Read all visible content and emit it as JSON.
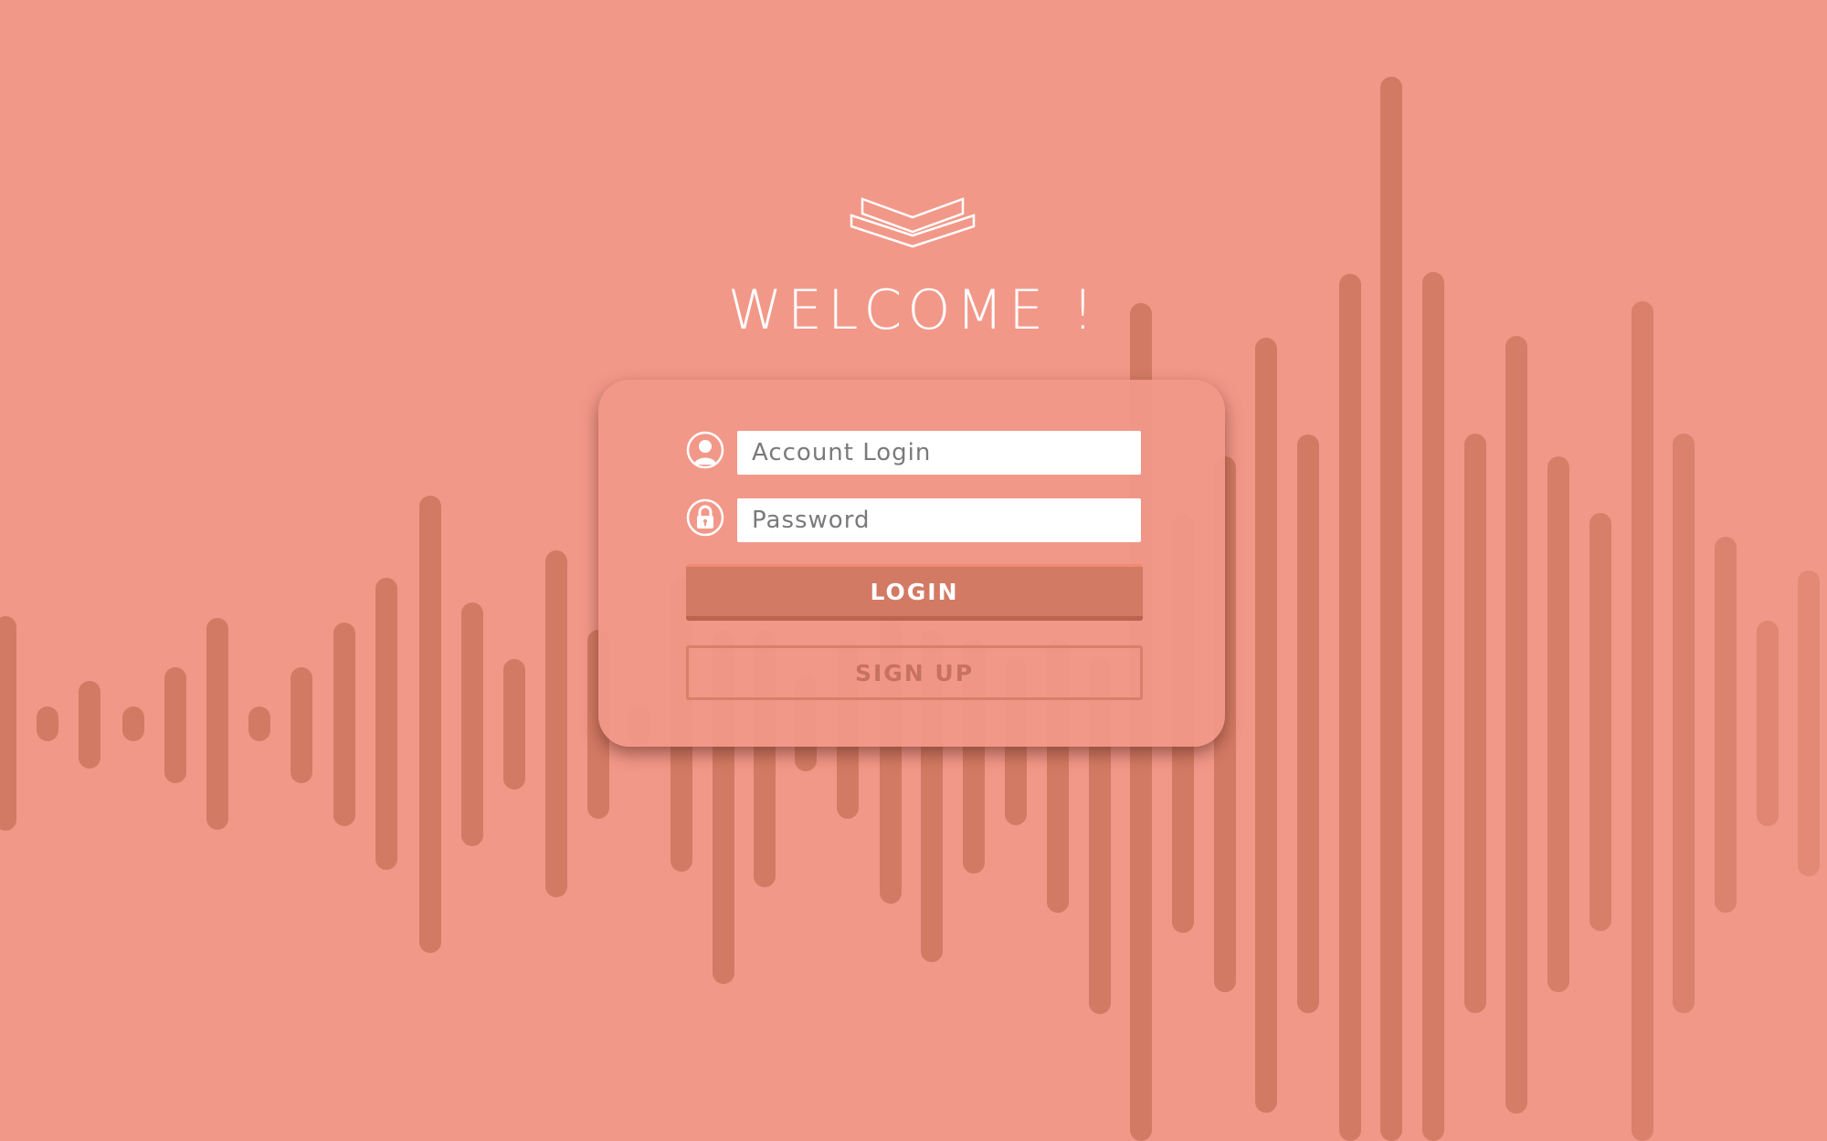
{
  "theme": {
    "background": "#f29889",
    "bar_color": "#d37a64",
    "accent": "#d37a64"
  },
  "header": {
    "logo_icon": "stacked-chevron-logo-icon",
    "welcome": "WELCOME !"
  },
  "form": {
    "account": {
      "icon": "user-icon",
      "placeholder": "Account Login",
      "value": ""
    },
    "password": {
      "icon": "lock-icon",
      "placeholder": "Password",
      "value": ""
    },
    "login_label": "LOGIN",
    "signup_label": "SIGN UP"
  }
}
